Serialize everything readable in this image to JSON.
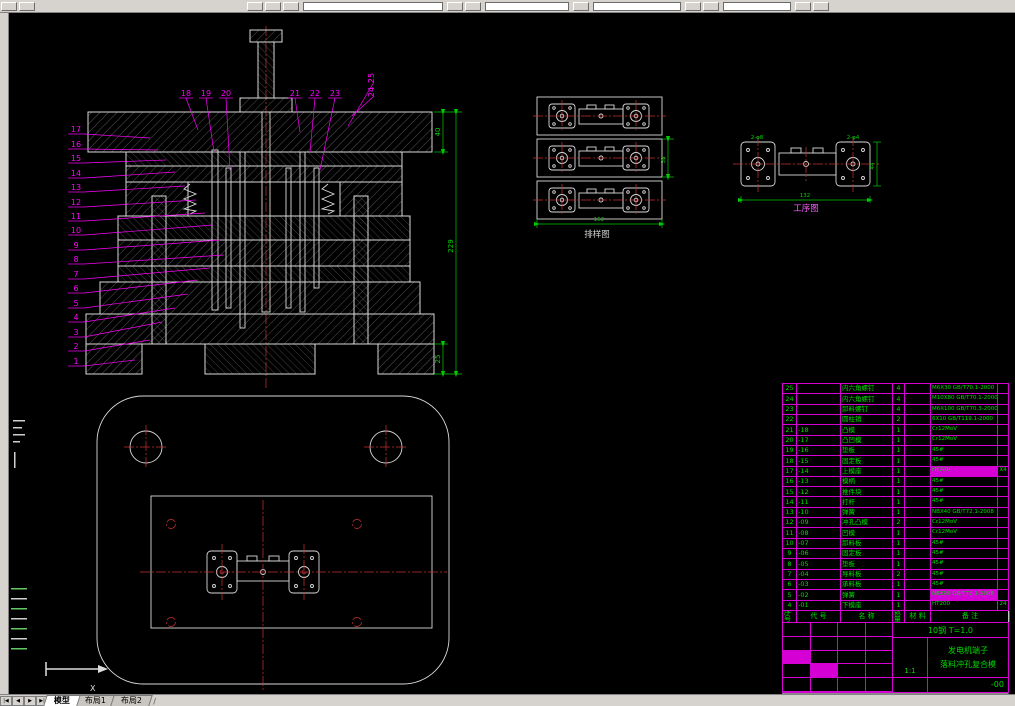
{
  "chrome": {
    "tabs": {
      "nav": [
        "|◀",
        "◀",
        "▶",
        "▶|"
      ],
      "items": [
        "模型",
        "布局1",
        "布局2"
      ],
      "active": "模型",
      "trailing": "/"
    }
  },
  "drawing": {
    "callouts_left": [
      "17",
      "16",
      "15",
      "14",
      "13",
      "12",
      "11",
      "10",
      "9",
      "8",
      "7",
      "6",
      "5",
      "4",
      "3",
      "2",
      "1"
    ],
    "callouts_top": [
      "18",
      "19",
      "20",
      "21",
      "22",
      "23"
    ],
    "callouts_side": [
      "24",
      "25"
    ],
    "dims": {
      "overall_height": "229",
      "top_plate": "40",
      "base_plate": "25",
      "strip_width": "38",
      "strip_length": "152",
      "part_length": "132",
      "part_width": "44",
      "hole_left": "2-φ8",
      "hole_right": "2-φ4"
    },
    "labels": {
      "strip": "排样图",
      "process": "工序图"
    },
    "ucs_axis": "X"
  },
  "bom": {
    "header": [
      "序号",
      "代 号",
      "名 称",
      "数量",
      "材 料",
      "备 注"
    ],
    "rows": [
      {
        "no": "25",
        "code": "",
        "name": "内六角螺钉",
        "qty": "4",
        "extra": "",
        "spec": "M6X30 GB/T70.1-2000",
        "note": "",
        "hl": false
      },
      {
        "no": "24",
        "code": "",
        "name": "内六角螺钉",
        "qty": "4",
        "extra": "",
        "spec": "M10X80 GB/T70.1-2000",
        "note": "",
        "hl": false
      },
      {
        "no": "23",
        "code": "",
        "name": "卸料螺钉",
        "qty": "4",
        "extra": "",
        "spec": "M6X100 GB/T70.3-2000",
        "note": "",
        "hl": false
      },
      {
        "no": "22",
        "code": "",
        "name": "圆柱销",
        "qty": "2",
        "extra": "",
        "spec": "6X10 GB/T119.1-2000",
        "note": "",
        "hl": false
      },
      {
        "no": "21",
        "code": "-18",
        "name": "凸模",
        "qty": "1",
        "extra": "",
        "spec": "Cr12MoV",
        "note": "",
        "hl": false
      },
      {
        "no": "20",
        "code": "-17",
        "name": "凸凹模",
        "qty": "1",
        "extra": "",
        "spec": "Cr12MoV",
        "note": "",
        "hl": false
      },
      {
        "no": "19",
        "code": "-16",
        "name": "垫板",
        "qty": "1",
        "extra": "",
        "spec": "45#",
        "note": "",
        "hl": false
      },
      {
        "no": "18",
        "code": "-15",
        "name": "固定板",
        "qty": "1",
        "extra": "",
        "spec": "45#",
        "note": "",
        "hl": false
      },
      {
        "no": "17",
        "code": "-14",
        "name": "上模座",
        "qty": "1",
        "extra": "",
        "spec": "HT200",
        "note": "X4",
        "hl": true
      },
      {
        "no": "16",
        "code": "-13",
        "name": "模柄",
        "qty": "1",
        "extra": "",
        "spec": "45#",
        "note": "",
        "hl": false
      },
      {
        "no": "15",
        "code": "-12",
        "name": "推件块",
        "qty": "1",
        "extra": "",
        "spec": "45#",
        "note": "",
        "hl": false
      },
      {
        "no": "14",
        "code": "-11",
        "name": "打杆",
        "qty": "1",
        "extra": "",
        "spec": "45#",
        "note": "",
        "hl": false
      },
      {
        "no": "13",
        "code": "-10",
        "name": "弹簧",
        "qty": "1",
        "extra": "",
        "spec": "NBX40 GB/T72.1-2008",
        "note": "",
        "hl": false
      },
      {
        "no": "12",
        "code": "-09",
        "name": "冲孔凸模",
        "qty": "2",
        "extra": "",
        "spec": "Cr12MoV",
        "note": "",
        "hl": false
      },
      {
        "no": "11",
        "code": "-08",
        "name": "凹模",
        "qty": "1",
        "extra": "",
        "spec": "Cr12MoV",
        "note": "",
        "hl": false
      },
      {
        "no": "10",
        "code": "-07",
        "name": "卸料板",
        "qty": "1",
        "extra": "",
        "spec": "45#",
        "note": "",
        "hl": false
      },
      {
        "no": "9",
        "code": "-06",
        "name": "固定板",
        "qty": "1",
        "extra": "",
        "spec": "45#",
        "note": "",
        "hl": false
      },
      {
        "no": "8",
        "code": "-05",
        "name": "垫板",
        "qty": "1",
        "extra": "",
        "spec": "45#",
        "note": "",
        "hl": false
      },
      {
        "no": "7",
        "code": "-04",
        "name": "导料板",
        "qty": "2",
        "extra": "",
        "spec": "45#",
        "note": "",
        "hl": false
      },
      {
        "no": "6",
        "code": "-03",
        "name": "承料板",
        "qty": "1",
        "extra": "",
        "spec": "45#",
        "note": "",
        "hl": false
      },
      {
        "no": "5",
        "code": "-02",
        "name": "弹簧",
        "qty": "1",
        "extra": "",
        "spec": "NBX56 GB/T72.1-2008",
        "note": "",
        "hl": true
      },
      {
        "no": "4",
        "code": "-01",
        "name": "下模座",
        "qty": "1",
        "extra": "",
        "spec": "HT200",
        "note": "24",
        "hl": false
      }
    ]
  },
  "title_block": {
    "material": "10钢 T=1.0",
    "product": "发电机端子",
    "title": "落料冲孔复合模",
    "scale": "1:1",
    "drawing_no": "-00"
  },
  "colors": {
    "background": "#000000",
    "chrome": "#d6d3ce",
    "line": "#d9d9d9",
    "magenta": "#ff00ff",
    "table_grid": "#d400d4",
    "dimension_green": "#00cc00",
    "centerline_red": "#c83232"
  }
}
